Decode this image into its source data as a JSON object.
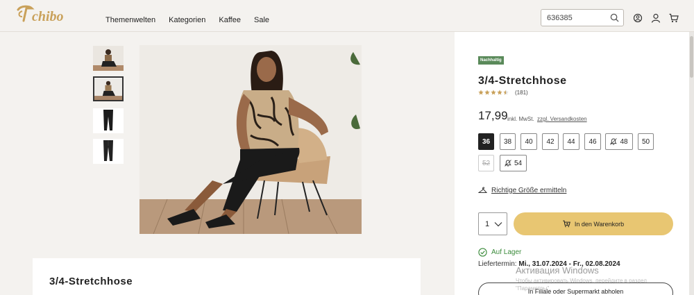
{
  "brand": {
    "name": "Tchibo",
    "color": "#c9a15a"
  },
  "nav": {
    "items": [
      "Themenwelten",
      "Kategorien",
      "Kaffee",
      "Sale"
    ]
  },
  "search": {
    "value": "636385",
    "icon": "search-icon"
  },
  "header_icons": [
    "store-locator-icon",
    "account-icon",
    "cart-icon"
  ],
  "gallery": {
    "thumbnails": [
      "thumb-model-seated-1",
      "thumb-model-seated-2",
      "thumb-pants-front",
      "thumb-pants-back"
    ],
    "selected_index": 1
  },
  "product": {
    "badge": "Nachhaltig",
    "badge_color": "#5a8a5a",
    "title": "3/4-Stretchhose",
    "rating": 4.5,
    "rating_count": "(181)",
    "price": "17,99",
    "price_note": "inkl. MwSt.",
    "shipping_link": "zzgl. Versandkosten"
  },
  "sizes": [
    {
      "label": "36",
      "state": "selected",
      "bell": false
    },
    {
      "label": "38",
      "state": "available",
      "bell": false
    },
    {
      "label": "40",
      "state": "available",
      "bell": false
    },
    {
      "label": "42",
      "state": "available",
      "bell": false
    },
    {
      "label": "44",
      "state": "available",
      "bell": false
    },
    {
      "label": "46",
      "state": "available",
      "bell": false
    },
    {
      "label": "48",
      "state": "available",
      "bell": true
    },
    {
      "label": "50",
      "state": "available",
      "bell": false
    },
    {
      "label": "52",
      "state": "disabled",
      "bell": false
    },
    {
      "label": "54",
      "state": "available",
      "bell": true
    }
  ],
  "size_finder": {
    "label": "Richtige Größe ermitteln"
  },
  "cart": {
    "quantity": "1",
    "button_label": "In den Warenkorb",
    "button_color": "#e8c672"
  },
  "availability": {
    "stock_label": "Auf Lager",
    "delivery_prefix": "Liefertermin:",
    "delivery_dates": "Mi., 31.07.2024 - Fr., 02.08.2024",
    "store_button": "In Filiale oder Supermarkt abholen"
  },
  "watermark": {
    "title": "Активация Windows",
    "subtitle": "Чтобы активировать Windows, перейдите в раздел \"Параметры\"."
  },
  "description": {
    "title": "3/4-Stretchhose"
  }
}
